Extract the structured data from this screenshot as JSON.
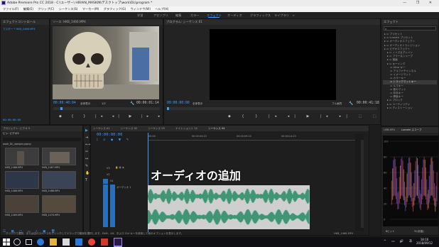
{
  "app": {
    "title": "Adobe Premiere Pro CC 2018 - C:\\ユーザー\\ HIRAIN_MASKIN\\デスクトップ\\work\\DL\\program *",
    "window_controls": "— ❐ ✕"
  },
  "menu": [
    "ファイル(F)",
    "編集(E)",
    "クリップ(C)",
    "シーケンス(S)",
    "マーカー(M)",
    "グラフィック(G)",
    "ウィンドウ(W)",
    "ヘルプ(H)"
  ],
  "workspaces": {
    "items": [
      "学習",
      "アセンブリ",
      "編集",
      "カラー",
      "エフェクト",
      "オーディオ",
      "グラフィックス",
      "ライブラリ"
    ],
    "active": "エフェクト",
    "more": "»"
  },
  "effect_controls": {
    "tab": "エフェクトコントロール",
    "clip_label": "マスター * HKB_1466.MP4",
    "bottom_tc": "00:00:00:00"
  },
  "source_monitor": {
    "tab": "ソース: HKB_1466.MP4",
    "timecode": "00:00:40:04",
    "fit": "全体表示",
    "ratio": "1/2",
    "duration": "00:00:01:14"
  },
  "program_monitor": {
    "tab": "プログラム: シーケンス 01",
    "timecode": "00:00:00:00",
    "fit": "全体表示",
    "ratio": "フル画質",
    "duration": "00:00:41:18"
  },
  "project": {
    "tabs": [
      "プロジェクト: ビデオ 5",
      "メディアブラウザー",
      "ライブラリ",
      "情報",
      "エフェクト"
    ],
    "bin": "ビン: ビデオ5",
    "path": "work_DL_sample.prproj",
    "count": "1/4 項目が選択されました",
    "clips": [
      "HKB_1466.MP4",
      "HKB_1487.MP4",
      "HKB_1468.MP4",
      "HKB_1486.MP4",
      "HKB_1469.MP4",
      "HKB_1470.MP4"
    ]
  },
  "timeline": {
    "tabs": [
      "シーケンス 01",
      "シーケンス 02",
      "シーケンス 03",
      "ナイトショット 12",
      "シーケンス 04"
    ],
    "timecode": "00:00:00:00",
    "ruler": [
      "00:00",
      "00:00:04:23",
      "00:00:09:23",
      "00:00:14:23"
    ],
    "tracks": [
      "V3",
      "V2",
      "V1",
      "A1",
      "A2",
      "A3"
    ],
    "track_name": "オーディオ 1",
    "master": "マスター",
    "master_val": "0.0"
  },
  "overlay": {
    "caption": "オーディオの追加"
  },
  "effects_panel": {
    "tab": "エフェクト",
    "search_placeholder": "",
    "items": [
      "プリセット",
      "Lumetri プリセット",
      "オーディオエフェクト",
      "オーディオトランジション",
      "ビデオエフェクト",
      "ノイズ＆グレイン",
      "ブラー＆シャープ",
      "描画",
      "キーイング",
      "Ultra キー",
      "アルファチャンネル",
      "イメージマット",
      "カラーキー",
      "トラックマットキー",
      "ルマキー",
      "差のマット",
      "非赤キー",
      "輝度キー",
      "ブロック",
      "ユーティリティ",
      "ディストーション"
    ],
    "selected_index": 13
  },
  "scopes": {
    "tab": "Lumetri スコープ",
    "tab2": "LMB.MP4",
    "ticks": [
      "100",
      "80",
      "60",
      "40",
      "20",
      "0"
    ],
    "bottom_label": "8ビット",
    "bottom_opt": "YC(彩度)"
  },
  "status_bar": {
    "text": "クリックで選択、または空のスペースをクリックしてドラッグで範囲を選択します。Shift、Alt、および Ctrl キーを使用して他のオプションを表示します。",
    "right": "HKB_1468.MP4"
  },
  "taskbar": {
    "time": "18:16",
    "date": "2018/09/12"
  },
  "colors": {
    "accent": "#3b9bff",
    "waveform": "#2f8f6a",
    "audio_clip": "#cfcfcf"
  }
}
